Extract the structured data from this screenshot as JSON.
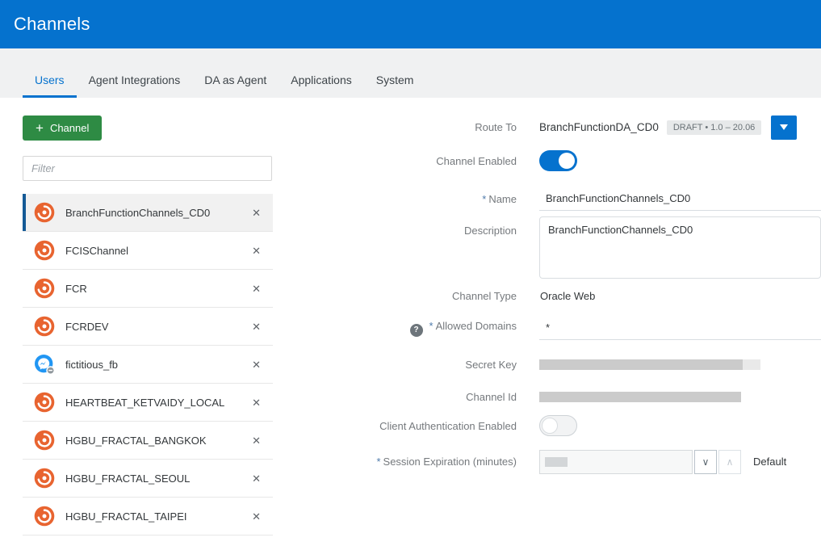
{
  "header": {
    "title": "Channels"
  },
  "tabs": [
    {
      "label": "Users",
      "active": true
    },
    {
      "label": "Agent Integrations",
      "active": false
    },
    {
      "label": "DA as Agent",
      "active": false
    },
    {
      "label": "Applications",
      "active": false
    },
    {
      "label": "System",
      "active": false
    }
  ],
  "left_panel": {
    "add_button_label": "Channel",
    "add_button_plus": "+",
    "filter_placeholder": "Filter",
    "delete_glyph": "✕",
    "channels": [
      {
        "name": "BranchFunctionChannels_CD0",
        "icon": "oda",
        "selected": true
      },
      {
        "name": "FCISChannel",
        "icon": "oda",
        "selected": false
      },
      {
        "name": "FCR",
        "icon": "oda",
        "selected": false
      },
      {
        "name": "FCRDEV",
        "icon": "oda",
        "selected": false
      },
      {
        "name": "fictitious_fb",
        "icon": "messenger",
        "selected": false
      },
      {
        "name": "HEARTBEAT_KETVAIDY_LOCAL",
        "icon": "oda",
        "selected": false
      },
      {
        "name": "HGBU_FRACTAL_BANGKOK",
        "icon": "oda",
        "selected": false
      },
      {
        "name": "HGBU_FRACTAL_SEOUL",
        "icon": "oda",
        "selected": false
      },
      {
        "name": "HGBU_FRACTAL_TAIPEI",
        "icon": "oda",
        "selected": false
      }
    ]
  },
  "form": {
    "route_to": {
      "label": "Route To",
      "value": "BranchFunctionDA_CD0",
      "badge": "DRAFT • 1.0 – 20.06"
    },
    "channel_enabled": {
      "label": "Channel Enabled",
      "enabled": true
    },
    "name": {
      "label": "Name",
      "required": "*",
      "value": "BranchFunctionChannels_CD0"
    },
    "description": {
      "label": "Description",
      "value": "BranchFunctionChannels_CD0"
    },
    "channel_type": {
      "label": "Channel Type",
      "value": "Oracle Web"
    },
    "allowed_domains": {
      "label": "Allowed Domains",
      "required": "*",
      "help": "?",
      "value": "*"
    },
    "secret_key": {
      "label": "Secret Key"
    },
    "channel_id": {
      "label": "Channel Id"
    },
    "client_auth": {
      "label": "Client Authentication Enabled",
      "enabled": false
    },
    "session_expiration": {
      "label": "Session Expiration (minutes)",
      "required": "*",
      "default_label": "Default"
    }
  },
  "colors": {
    "accent": "#0572CE",
    "green": "#2e8b44",
    "selbar": "#155a96",
    "redact": "#cbcbcb"
  }
}
